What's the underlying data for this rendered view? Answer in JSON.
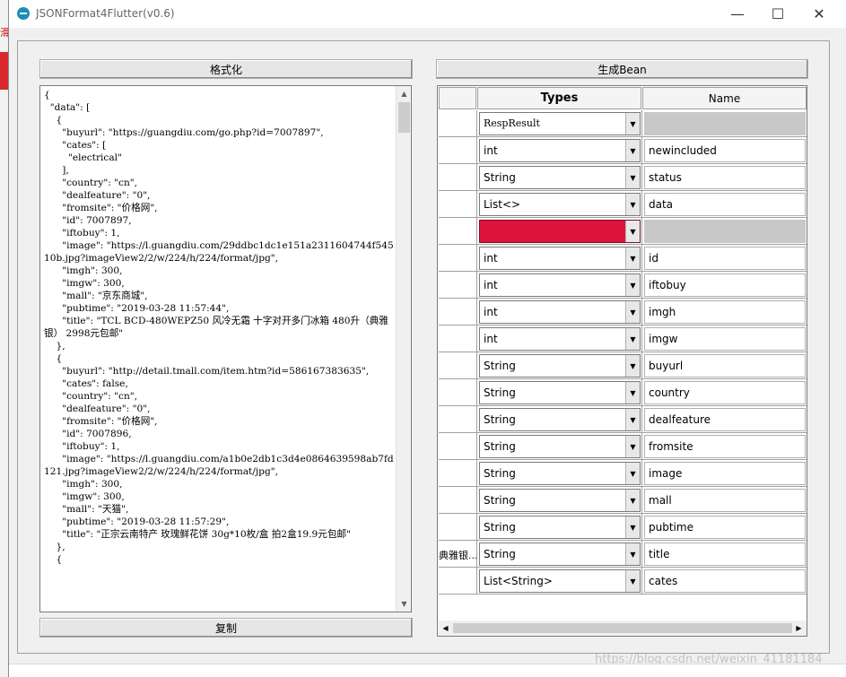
{
  "window": {
    "title": "JSONFormat4Flutter(v0.6)",
    "minimize_glyph": "—",
    "maximize_glyph": "☐",
    "close_glyph": "✕"
  },
  "left": {
    "format_button": "格式化",
    "copy_button": "复制",
    "json_text": "{\n  \"data\": [\n    {\n      \"buyurl\": \"https://guangdiu.com/go.php?id=7007897\",\n      \"cates\": [\n        \"electrical\"\n      ],\n      \"country\": \"cn\",\n      \"dealfeature\": \"0\",\n      \"fromsite\": \"价格网\",\n      \"id\": 7007897,\n      \"iftobuy\": 1,\n      \"image\": \"https://l.guangdiu.com/29ddbc1dc1e151a2311604744f54510b.jpg?imageView2/2/w/224/h/224/format/jpg\",\n      \"imgh\": 300,\n      \"imgw\": 300,\n      \"mall\": \"京东商城\",\n      \"pubtime\": \"2019-03-28 11:57:44\",\n      \"title\": \"TCL BCD-480WEPZ50 风冷无霜 十字对开多门冰箱 480升（典雅银） 2998元包邮\"\n    },\n    {\n      \"buyurl\": \"http://detail.tmall.com/item.htm?id=586167383635\",\n      \"cates\": false,\n      \"country\": \"cn\",\n      \"dealfeature\": \"0\",\n      \"fromsite\": \"价格网\",\n      \"id\": 7007896,\n      \"iftobuy\": 1,\n      \"image\": \"https://l.guangdiu.com/a1b0e2db1c3d4e0864639598ab7fd121.jpg?imageView2/2/w/224/h/224/format/jpg\",\n      \"imgh\": 300,\n      \"imgw\": 300,\n      \"mall\": \"天猫\",\n      \"pubtime\": \"2019-03-28 11:57:29\",\n      \"title\": \"正宗云南特产 玫瑰鲜花饼 30g*10枚/盒 拍2盒19.9元包邮\"\n    },\n    {"
  },
  "right": {
    "generate_button": "生成Bean",
    "headers": {
      "types": "Types",
      "name": "Name"
    },
    "rows": [
      {
        "rowlabel": "",
        "type": "RespResult",
        "name": "",
        "highlight": false,
        "gray": true,
        "serif": true
      },
      {
        "rowlabel": "",
        "type": "int",
        "name": "newincluded"
      },
      {
        "rowlabel": "",
        "type": "String",
        "name": "status"
      },
      {
        "rowlabel": "",
        "type": "List<>",
        "name": "data"
      },
      {
        "rowlabel": "",
        "type": "",
        "name": "",
        "highlight": true,
        "gray": true
      },
      {
        "rowlabel": "",
        "type": "int",
        "name": "id"
      },
      {
        "rowlabel": "",
        "type": "int",
        "name": "iftobuy"
      },
      {
        "rowlabel": "",
        "type": "int",
        "name": "imgh"
      },
      {
        "rowlabel": "",
        "type": "int",
        "name": "imgw"
      },
      {
        "rowlabel": "",
        "type": "String",
        "name": "buyurl"
      },
      {
        "rowlabel": "",
        "type": "String",
        "name": "country"
      },
      {
        "rowlabel": "",
        "type": "String",
        "name": "dealfeature"
      },
      {
        "rowlabel": "",
        "type": "String",
        "name": "fromsite"
      },
      {
        "rowlabel": "",
        "type": "String",
        "name": "image"
      },
      {
        "rowlabel": "",
        "type": "String",
        "name": "mall"
      },
      {
        "rowlabel": "",
        "type": "String",
        "name": "pubtime"
      },
      {
        "rowlabel": "典雅银...",
        "type": "String",
        "name": "title"
      },
      {
        "rowlabel": "",
        "type": "List<String>",
        "name": "cates"
      }
    ]
  },
  "watermark": "https://blog.csdn.net/weixin_41181184",
  "background_strip_text": "滑",
  "colors": {
    "highlight": "#dc143c",
    "gray_cell": "#c8c8c8"
  },
  "icons": {
    "app": "app-logo-icon",
    "dropdown": "chevron-down-icon",
    "scroll_up": "arrow-up-icon",
    "scroll_down": "arrow-down-icon",
    "scroll_left": "arrow-left-icon",
    "scroll_right": "arrow-right-icon"
  }
}
